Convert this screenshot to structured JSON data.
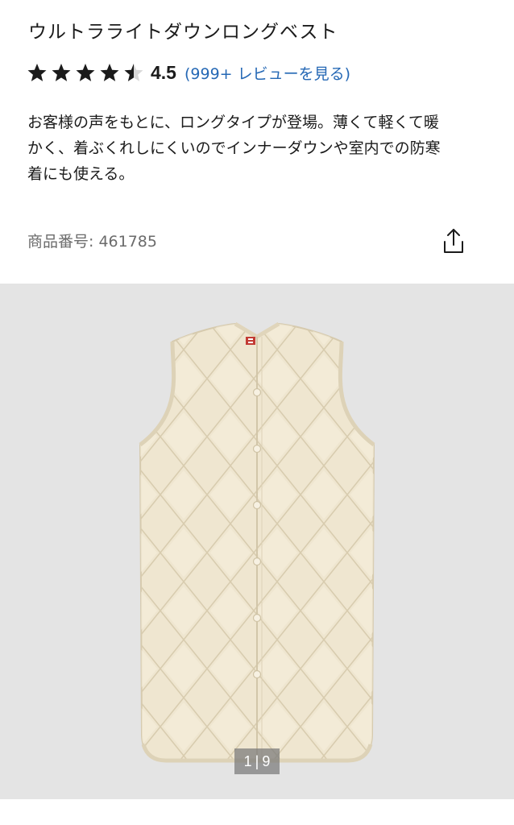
{
  "product": {
    "title": "ウルトラライトダウンロングベスト",
    "rating": {
      "value_label": "4.5",
      "value": 4.5,
      "max": 5,
      "review_link": "(999+ レビューを見る)"
    },
    "description_lines": [
      "お客様の声をもとに、ロングタイプが登場。薄くて軽くて暖",
      "かく、着ぶくれしにくいのでインナーダウンや室内での防寒",
      "着にも使える。"
    ],
    "product_number": "商品番号: 461785",
    "share_icon": "share-icon"
  },
  "gallery": {
    "current": "1",
    "separator": "|",
    "total": "9",
    "image_name": "long-down-vest-photo",
    "brand_tag": "UNIQLO"
  },
  "colors": {
    "link": "#2568b5",
    "gallery_bg": "#e4e4e4",
    "garment": "#efe6d0",
    "text": "#1b1b1b",
    "muted": "#6b6b6b"
  }
}
